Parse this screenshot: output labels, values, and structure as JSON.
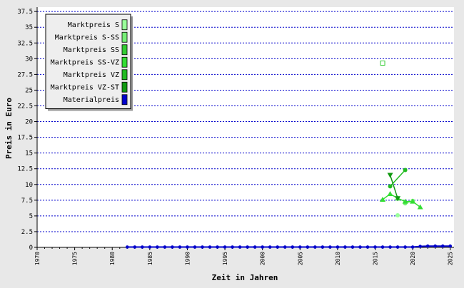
{
  "chart_data": {
    "type": "line",
    "xlabel": "Zeit in Jahren",
    "ylabel": "Preis in Euro",
    "xlim": [
      1970,
      2025
    ],
    "ylim": [
      0,
      37.5
    ],
    "xticks": [
      1970,
      1975,
      1980,
      1985,
      1990,
      1995,
      2000,
      2005,
      2010,
      2015,
      2020,
      2025
    ],
    "yticks": [
      0,
      2.5,
      5,
      7.5,
      10,
      12.5,
      15,
      17.5,
      20,
      22.5,
      25,
      27.5,
      30,
      32.5,
      35,
      37.5
    ],
    "grid": "horizontal-dotted",
    "legend_position": "top-left",
    "series": [
      {
        "name": "Marktpreis S",
        "color": "#99ff99",
        "marker": "circle",
        "points": [
          [
            2018,
            5.1
          ]
        ]
      },
      {
        "name": "Marktpreis S-SS",
        "color": "#77ee77",
        "marker": "circle",
        "points": [
          [
            2019,
            7.0
          ],
          [
            2020,
            7.4
          ]
        ]
      },
      {
        "name": "Marktpreis SS",
        "color": "#33cc33",
        "marker": "square-open",
        "points": [
          [
            2016,
            29.3
          ]
        ]
      },
      {
        "name": "Marktpreis SS-VZ",
        "color": "#33dd33",
        "marker": "triangle-up",
        "points": [
          [
            2016,
            7.6
          ],
          [
            2017,
            8.5
          ],
          [
            2018,
            7.8
          ],
          [
            2019,
            7.3
          ],
          [
            2020,
            7.3
          ],
          [
            2021,
            6.4
          ]
        ]
      },
      {
        "name": "Marktpreis VZ",
        "color": "#22bb22",
        "marker": "circle",
        "points": [
          [
            2017,
            9.7
          ],
          [
            2019,
            12.3
          ]
        ]
      },
      {
        "name": "Marktpreis VZ-ST",
        "color": "#119911",
        "marker": "triangle-down",
        "points": [
          [
            2017,
            11.5
          ],
          [
            2018,
            7.8
          ]
        ]
      },
      {
        "name": "Materialpreis",
        "color": "#0000cc",
        "marker": "circle",
        "points": [
          [
            1982,
            0.05
          ],
          [
            1983,
            0.05
          ],
          [
            1984,
            0.05
          ],
          [
            1985,
            0.05
          ],
          [
            1986,
            0.05
          ],
          [
            1987,
            0.05
          ],
          [
            1988,
            0.05
          ],
          [
            1989,
            0.05
          ],
          [
            1990,
            0.05
          ],
          [
            1991,
            0.05
          ],
          [
            1992,
            0.05
          ],
          [
            1993,
            0.05
          ],
          [
            1994,
            0.05
          ],
          [
            1995,
            0.05
          ],
          [
            1996,
            0.05
          ],
          [
            1997,
            0.05
          ],
          [
            1998,
            0.05
          ],
          [
            1999,
            0.05
          ],
          [
            2000,
            0.05
          ],
          [
            2001,
            0.05
          ],
          [
            2002,
            0.05
          ],
          [
            2003,
            0.05
          ],
          [
            2004,
            0.05
          ],
          [
            2005,
            0.05
          ],
          [
            2006,
            0.05
          ],
          [
            2007,
            0.05
          ],
          [
            2008,
            0.05
          ],
          [
            2009,
            0.05
          ],
          [
            2010,
            0.05
          ],
          [
            2011,
            0.05
          ],
          [
            2012,
            0.05
          ],
          [
            2013,
            0.05
          ],
          [
            2014,
            0.05
          ],
          [
            2015,
            0.05
          ],
          [
            2016,
            0.05
          ],
          [
            2017,
            0.05
          ],
          [
            2018,
            0.05
          ],
          [
            2019,
            0.05
          ],
          [
            2020,
            0.05
          ],
          [
            2021,
            0.15
          ],
          [
            2022,
            0.2
          ],
          [
            2023,
            0.2
          ],
          [
            2024,
            0.2
          ],
          [
            2025,
            0.2
          ]
        ]
      }
    ]
  }
}
